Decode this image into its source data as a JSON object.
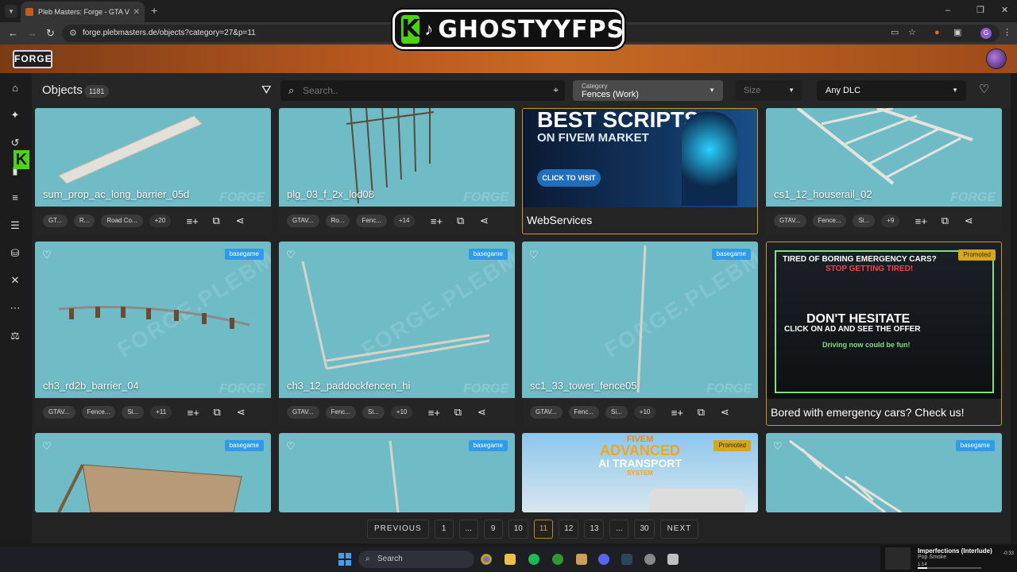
{
  "browser": {
    "tab_title": "Pleb Masters: Forge - GTA V Ob",
    "url": "forge.plebmasters.de/objects?category=27&p=11"
  },
  "overlay": {
    "k": "K",
    "name": "GHOSTYYFPS"
  },
  "site": {
    "logo": "FORGE"
  },
  "leftnav": {
    "counter_k": "K",
    "counter_num": "1"
  },
  "toolbar": {
    "title": "Objects",
    "count": "1181",
    "search_placeholder": "Search..",
    "category_caption": "Category",
    "category_value": "Fences (Work)",
    "size_value": "Size",
    "dlc_value": "Any DLC"
  },
  "cards": [
    {
      "name": "sum_prop_ac_long_barrier_05d",
      "chips": [
        "GT...",
        "R...",
        "Road Co...",
        "+20"
      ]
    },
    {
      "name": "plg_03_f_2x_lod08",
      "chips": [
        "GTAV...",
        "Ro...",
        "Fenc...",
        "+14"
      ]
    },
    {
      "ad_label": "WebServices",
      "ad_headline": "BEST SCRIPTS",
      "ad_sub": "ON FIVEM MARKET",
      "ad_button": "CLICK TO VISIT"
    },
    {
      "name": "cs1_12_houserail_02",
      "chips": [
        "GTAV...",
        "Fence...",
        "Si...",
        "+9"
      ]
    },
    {
      "name": "ch3_rd2b_barrier_04",
      "badge": "basegame",
      "chips": [
        "GTAV...",
        "Fence...",
        "Si...",
        "+11"
      ]
    },
    {
      "name": "ch3_12_paddockfencen_hi",
      "badge": "basegame",
      "chips": [
        "GTAV...",
        "Fenc...",
        "Si...",
        "+10"
      ]
    },
    {
      "name": "sc1_33_tower_fence05",
      "badge": "basegame",
      "chips": [
        "GTAV...",
        "Fenc...",
        "Si...",
        "+10"
      ]
    },
    {
      "ad_label": "Bored with emergency cars? Check us!",
      "badge": "Promoted",
      "ad_line1": "TIRED OF BORING EMERGENCY CARS?",
      "ad_line2": "STOP GETTING TIRED!",
      "ad_line3": "DON'T HESITATE",
      "ad_line4": "CLICK ON AD AND SEE THE OFFER",
      "ad_line5": "Driving now could be fun!"
    },
    {
      "badge": "basegame"
    },
    {
      "badge": "basegame"
    },
    {
      "badge": "Promoted",
      "ad_line1": "FIVEM",
      "ad_line2": "ADVANCED",
      "ad_line3": "AI TRANSPORT",
      "ad_line4": "SYSTEM"
    },
    {
      "badge": "basegame"
    }
  ],
  "watermark": "FORGE.PLEBMASTERS",
  "watermark_small": "FORGE",
  "pagination": [
    "PREVIOUS",
    "1",
    "...",
    "9",
    "10",
    "11",
    "12",
    "13",
    "...",
    "30",
    "NEXT"
  ],
  "pagination_active": "11",
  "taskbar": {
    "search_label": "Search"
  },
  "now_playing": {
    "title": "Imperfections (Interlude)",
    "artist": "Pop Smoke",
    "elapsed": "1:14",
    "remaining": "-0:33"
  },
  "colors": {
    "accent": "#c85a1e",
    "thumb_bg": "#6fbcc7",
    "badge": "#2f9bea",
    "promoted": "#d6a817",
    "overlay_green": "#4ad411"
  }
}
